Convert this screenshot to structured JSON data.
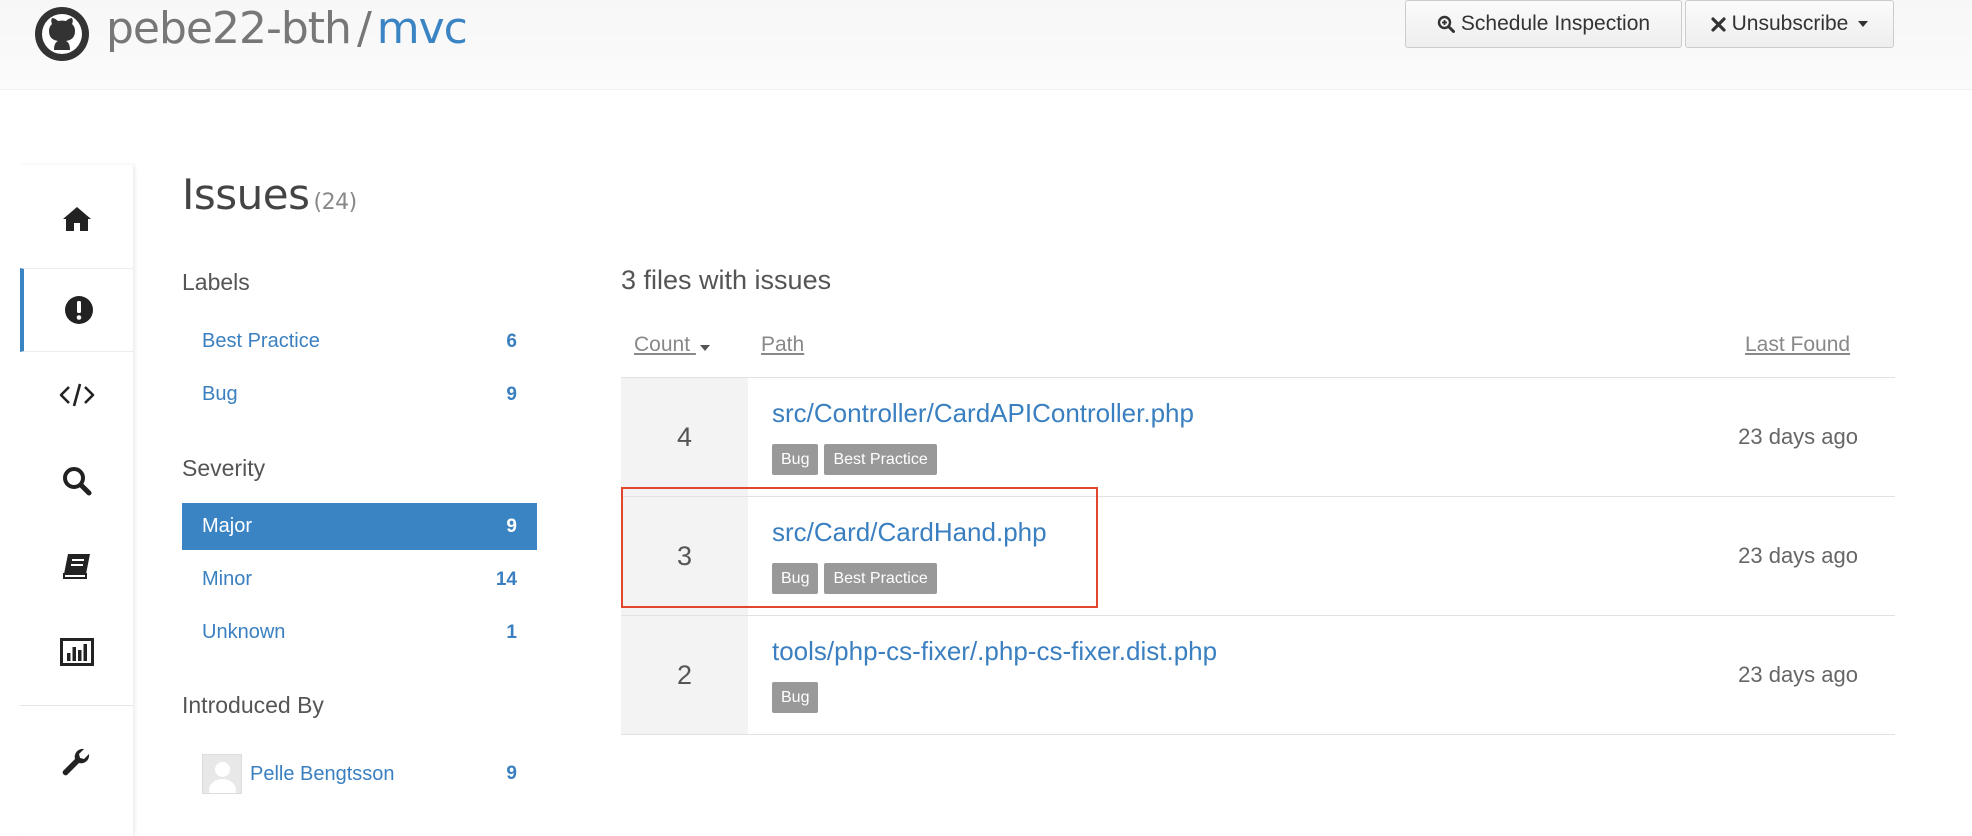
{
  "header": {
    "owner": "pebe22-bth",
    "separator": "/",
    "repo": "mvc",
    "schedule_button": "Schedule Inspection",
    "unsubscribe_button": "Unsubscribe"
  },
  "rail": {
    "items": [
      {
        "icon": "home-icon"
      },
      {
        "icon": "issues-icon",
        "active": true
      },
      {
        "icon": "code-icon"
      },
      {
        "icon": "search-icon"
      },
      {
        "icon": "book-icon"
      },
      {
        "icon": "chart-icon"
      },
      {
        "icon": "wrench-icon"
      }
    ]
  },
  "page": {
    "title": "Issues",
    "count": "(24)"
  },
  "filters": {
    "labels_title": "Labels",
    "labels": [
      {
        "label": "Best Practice",
        "count": "6"
      },
      {
        "label": "Bug",
        "count": "9"
      }
    ],
    "severity_title": "Severity",
    "severity": [
      {
        "label": "Major",
        "count": "9",
        "selected": true
      },
      {
        "label": "Minor",
        "count": "14"
      },
      {
        "label": "Unknown",
        "count": "1"
      }
    ],
    "introduced_title": "Introduced By",
    "introduced": [
      {
        "label": "Pelle Bengtsson",
        "count": "9"
      }
    ]
  },
  "files": {
    "title": "3 files with issues",
    "columns": {
      "count": "Count",
      "path": "Path",
      "last_found": "Last Found"
    },
    "rows": [
      {
        "count": "4",
        "path": "src/Controller/CardAPIController.php",
        "tags": [
          "Bug",
          "Best Practice"
        ],
        "last_found": "23 days ago"
      },
      {
        "count": "3",
        "path": "src/Card/CardHand.php",
        "tags": [
          "Bug",
          "Best Practice"
        ],
        "last_found": "23 days ago"
      },
      {
        "count": "2",
        "path": "tools/php-cs-fixer/.php-cs-fixer.dist.php",
        "tags": [
          "Bug"
        ],
        "last_found": "23 days ago"
      }
    ]
  },
  "colors": {
    "accent": "#3a84c4",
    "link": "#3a7fc0",
    "tag_bg": "#999999",
    "highlight": "#e2472d"
  }
}
